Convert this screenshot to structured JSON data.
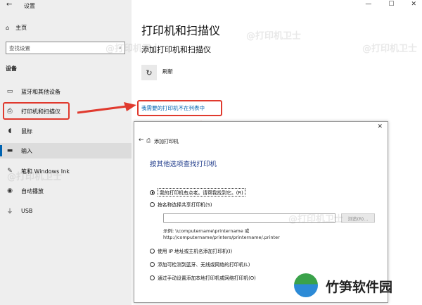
{
  "window": {
    "title": "设置",
    "minimize": "—",
    "maximize": "☐",
    "close": "✕"
  },
  "sidebar": {
    "home": "主页",
    "search_placeholder": "查找设置",
    "section": "设备",
    "items": [
      {
        "label": "蓝牙和其他设备",
        "icon": "bluetooth-icon"
      },
      {
        "label": "打印机和扫描仪",
        "icon": "printer-icon",
        "selected": true
      },
      {
        "label": "鼠标",
        "icon": "mouse-icon"
      },
      {
        "label": "输入",
        "icon": "keyboard-icon"
      },
      {
        "label": "笔和 Windows Ink",
        "icon": "pen-icon"
      },
      {
        "label": "自动播放",
        "icon": "autoplay-icon"
      },
      {
        "label": "USB",
        "icon": "usb-icon"
      }
    ]
  },
  "main": {
    "title": "打印机和扫描仪",
    "subtitle": "添加打印机和扫描仪",
    "refresh": "刷新",
    "not_listed": "我需要的打印机不在列表中"
  },
  "dialog": {
    "title": "添加打印机",
    "heading": "按其他选项查找打印机",
    "options": [
      {
        "label": "我的打印机有点老。请帮我找到它。(R)",
        "checked": true
      },
      {
        "label": "按名称选择共享打印机(S)",
        "checked": false
      },
      {
        "label": "使用 IP 地址或主机名添加打印机(I)",
        "checked": false
      },
      {
        "label": "添加可检测到蓝牙、无线或网络的打印机(L)",
        "checked": false
      },
      {
        "label": "通过手动设置添加本地打印机或网络打印机(O)",
        "checked": false
      }
    ],
    "browse": "浏览(R)...",
    "example_line1": "示例: \\\\computername\\printername 或",
    "example_line2": "http://computername/printers/printername/.printer"
  },
  "watermark": {
    "text": "@打印机卫士",
    "brand": "竹笋软件园"
  },
  "colors": {
    "accent": "#0063b1",
    "highlight": "#e03a2e"
  }
}
